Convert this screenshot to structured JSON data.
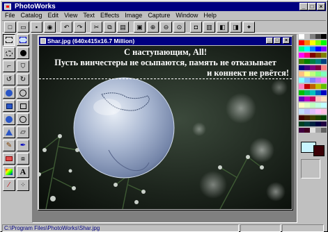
{
  "app": {
    "title": "PhotoWorks"
  },
  "menu": [
    "File",
    "Catalog",
    "Edit",
    "View",
    "Text",
    "Effects",
    "Image",
    "Capture",
    "Window",
    "Help"
  ],
  "toolbar": {
    "buttons": [
      {
        "name": "new-icon",
        "glyph": "□"
      },
      {
        "name": "open-icon",
        "glyph": "▭"
      },
      {
        "name": "save-icon",
        "glyph": "▪"
      },
      {
        "name": "scan-icon",
        "glyph": "◉"
      },
      {
        "name": "undo-icon",
        "glyph": "↶"
      },
      {
        "name": "redo-icon",
        "glyph": "↷"
      },
      {
        "name": "cut-icon",
        "glyph": "✂"
      },
      {
        "name": "copy-icon",
        "glyph": "⧉"
      },
      {
        "name": "paste-icon",
        "glyph": "▤"
      },
      {
        "name": "zoom-fit-icon",
        "glyph": "▣"
      },
      {
        "name": "zoom-in-icon",
        "glyph": "⊕"
      },
      {
        "name": "zoom-out-icon",
        "glyph": "⊖"
      },
      {
        "name": "zoom-actual-icon",
        "glyph": "⊙"
      },
      {
        "name": "camera-icon",
        "glyph": "◘"
      },
      {
        "name": "film-icon",
        "glyph": "▥"
      },
      {
        "name": "palette-icon",
        "glyph": "◧"
      },
      {
        "name": "layers-icon",
        "glyph": "◨"
      },
      {
        "name": "effects-icon",
        "glyph": "✦"
      }
    ]
  },
  "document": {
    "title": "Shar.jpg (640x415x16.7 Million)",
    "greeting_lines": [
      "С наступающим, All!",
      "Пусть винчестеры не осыпаются, память не отказывает",
      "и коннект не рвётся!"
    ]
  },
  "palette": {
    "colors": [
      "#ffffff",
      "#c0c0c0",
      "#808080",
      "#404040",
      "#000000",
      "#ff0000",
      "#ff8000",
      "#ffff00",
      "#80ff00",
      "#00ff00",
      "#00ff80",
      "#00ffff",
      "#0080ff",
      "#0000ff",
      "#8000ff",
      "#ff00ff",
      "#ff0080",
      "#800000",
      "#804000",
      "#808000",
      "#408000",
      "#008000",
      "#008040",
      "#008080",
      "#004080",
      "#000080",
      "#400080",
      "#800080",
      "#800040",
      "#ff8080",
      "#ffc080",
      "#ffff80",
      "#c0ff80",
      "#80ff80",
      "#80ffc0",
      "#80ffff",
      "#80c0ff",
      "#8080ff",
      "#c080ff",
      "#ff80ff",
      "#ff80c0",
      "#c00000",
      "#c06000",
      "#c0c000",
      "#60c000",
      "#00c000",
      "#00c060",
      "#00c0c0",
      "#0060c0",
      "#0000c0",
      "#6000c0",
      "#c000c0",
      "#c00060",
      "#ffc0c0",
      "#ffe0c0",
      "#ffffc0",
      "#e0ffc0",
      "#c0ffc0",
      "#c0ffe0",
      "#c0ffff",
      "#c0e0ff",
      "#c0c0ff",
      "#e0c0ff",
      "#ffc0ff",
      "#ffc0e0",
      "#400000",
      "#402000",
      "#404000",
      "#204000",
      "#004000",
      "#004020",
      "#004040",
      "#002040",
      "#000040",
      "#200040",
      "#400040",
      "#400020",
      "#e0e0e0",
      "#a0a0a0",
      "#606060"
    ],
    "foreground": "#c8f4ff",
    "background": "#3a0006"
  },
  "status": {
    "path": "C:\\Program Files\\PhotoWorks\\Shar.jpg",
    "panel2": "",
    "panel3": ""
  }
}
